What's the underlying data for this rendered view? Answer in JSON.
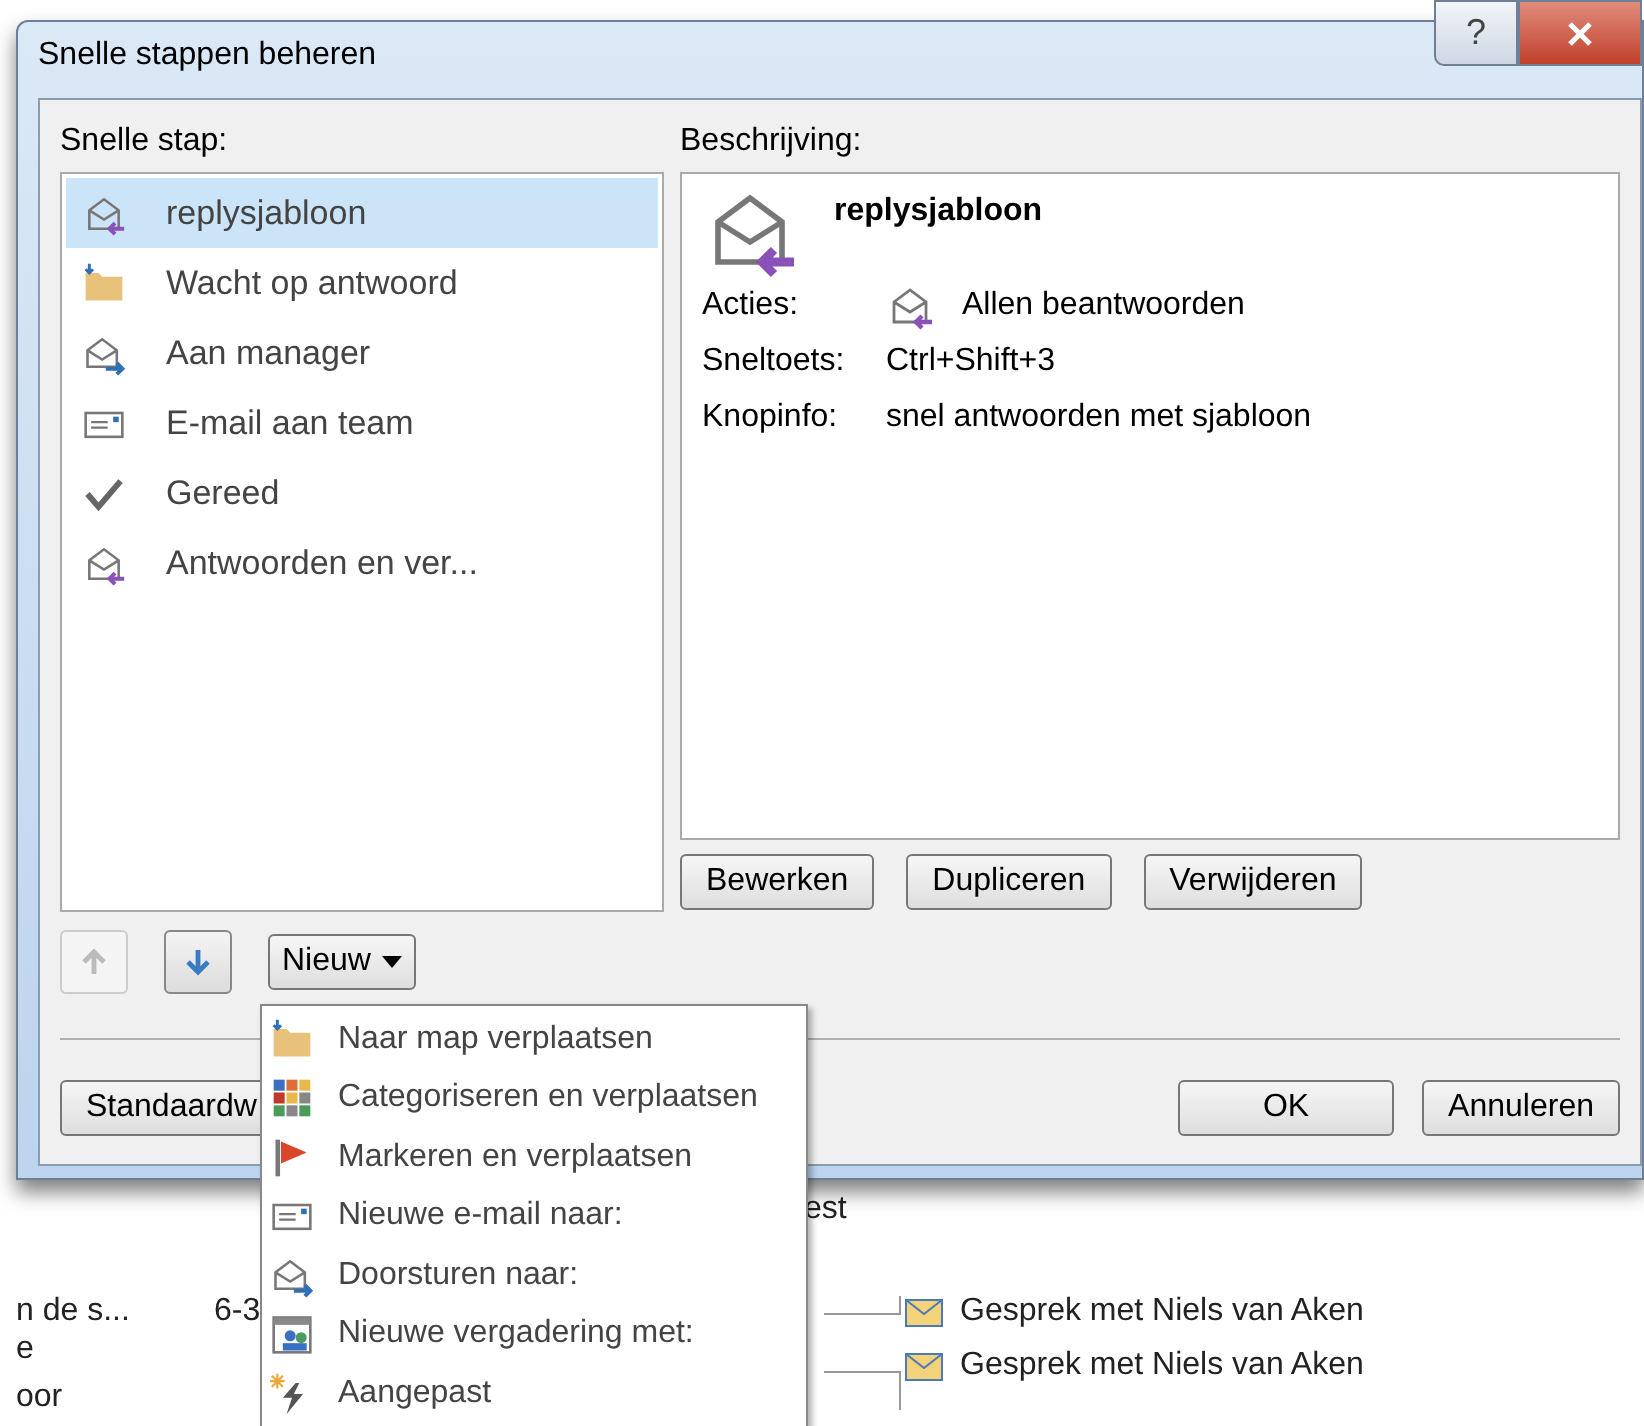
{
  "window": {
    "title": "Snelle stappen beheren",
    "help": "?"
  },
  "quick_steps": {
    "label": "Snelle stap:",
    "items": [
      {
        "label": "replysjabloon",
        "kind": "reply",
        "selected": true
      },
      {
        "label": "Wacht op antwoord",
        "kind": "folder",
        "selected": false
      },
      {
        "label": "Aan manager",
        "kind": "forward",
        "selected": false
      },
      {
        "label": "E-mail aan team",
        "kind": "email",
        "selected": false
      },
      {
        "label": "Gereed",
        "kind": "check",
        "selected": false
      },
      {
        "label": "Antwoorden en ver...",
        "kind": "reply",
        "selected": false
      }
    ]
  },
  "description": {
    "label": "Beschrijving:",
    "name": "replysjabloon",
    "rows": [
      {
        "label": "Acties:",
        "value": "Allen beantwoorden",
        "kind": "reply"
      },
      {
        "label": "Sneltoets:",
        "value": "Ctrl+Shift+3"
      },
      {
        "label": "Knopinfo:",
        "value": "snel antwoorden met sjabloon"
      }
    ]
  },
  "description_buttons": [
    "Bewerken",
    "Dupliceren",
    "Verwijderen"
  ],
  "move_buttons": [
    {
      "kind": "up",
      "disabled": true
    },
    {
      "kind": "down",
      "disabled": false
    }
  ],
  "new_button": {
    "label": "Nieuw"
  },
  "new_menu": [
    {
      "label": "Naar map verplaatsen",
      "kind": "folder"
    },
    {
      "label": "Categoriseren en verplaatsen",
      "kind": "categories"
    },
    {
      "label": "Markeren en verplaatsen",
      "kind": "flag"
    },
    {
      "label": "Nieuwe e-mail naar:",
      "kind": "email"
    },
    {
      "label": "Doorsturen naar:",
      "kind": "forward"
    },
    {
      "label": "Nieuwe vergadering met:",
      "kind": "meeting"
    },
    {
      "label": "Aangepast",
      "kind": "custom"
    }
  ],
  "footer_buttons": {
    "reset": "Standaardw",
    "ok": "OK",
    "cancel": "Annuleren"
  },
  "background": {
    "texts": [
      "n de s...",
      "6-3",
      "e",
      "oor",
      "est"
    ],
    "items": [
      "Gesprek met Niels van Aken",
      "Gesprek met Niels van Aken"
    ]
  }
}
